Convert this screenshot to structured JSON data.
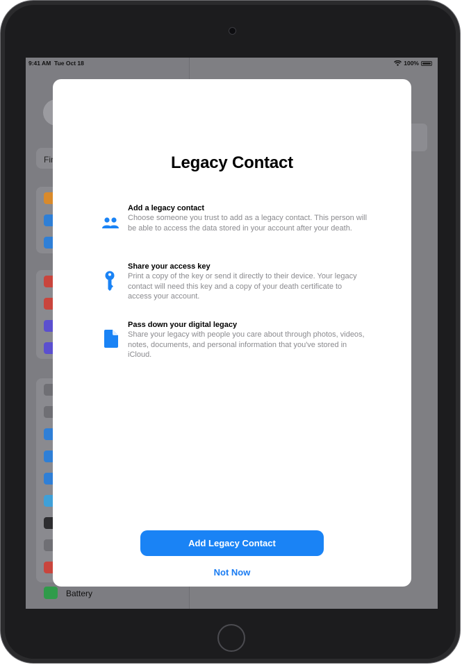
{
  "status_bar": {
    "time": "9:41 AM",
    "date": "Tue Oct 18",
    "battery": "100%"
  },
  "sidebar": {
    "partial_row_label": "Fin",
    "battery_label": "Battery",
    "icon_colors": [
      "#d98a2b",
      "#2f7fd6",
      "#2f7fd6",
      "#c9453d",
      "#c9453d",
      "#5b4fcf",
      "#5b4fcf",
      "#6f6f74",
      "#6f6f74",
      "#2f7fd6",
      "#2f7fd6",
      "#2f7fd6",
      "#3fa0d8",
      "#2d2d30",
      "#6f6f74",
      "#c9453d"
    ]
  },
  "modal": {
    "title": "Legacy Contact",
    "features": [
      {
        "icon": "people-icon",
        "title": "Add a legacy contact",
        "description": "Choose someone you trust to add as a legacy contact. This person will be able to access the data stored in your account after your death."
      },
      {
        "icon": "key-icon",
        "title": "Share your access key",
        "description": "Print a copy of the key or send it directly to their device. Your legacy contact will need this key and a copy of your death certificate to access your account."
      },
      {
        "icon": "document-icon",
        "title": "Pass down your digital legacy",
        "description": "Share your legacy with people you care about through photos, videos, notes, documents, and personal information that you've stored in iCloud."
      }
    ],
    "primary_button": "Add Legacy Contact",
    "secondary_button": "Not Now"
  },
  "colors": {
    "accent": "#1a83f5",
    "device_frame": "#2b2b2d",
    "dimmed_background": "#7f7f83"
  }
}
